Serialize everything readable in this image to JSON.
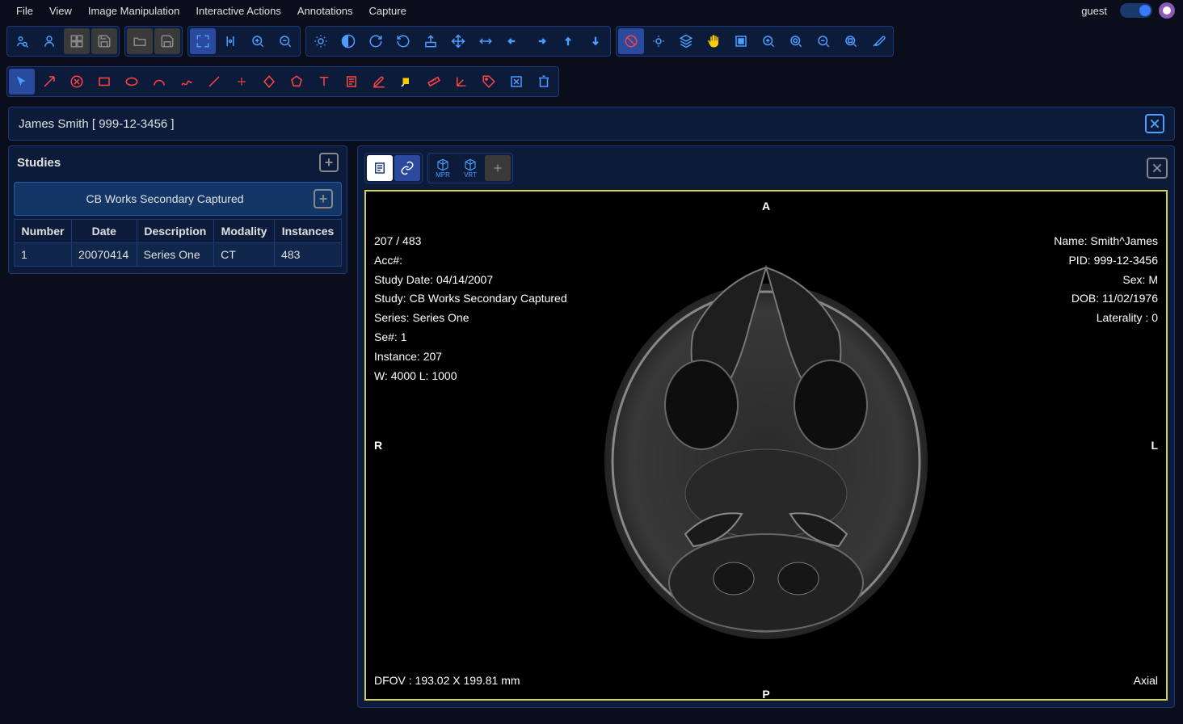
{
  "menu": {
    "items": [
      "File",
      "View",
      "Image Manipulation",
      "Interactive Actions",
      "Annotations",
      "Capture"
    ],
    "user": "guest"
  },
  "patient_header": "James Smith [ 999-12-3456 ]",
  "studies": {
    "title": "Studies",
    "study_name": "CB Works Secondary Captured",
    "columns": [
      "Number",
      "Date",
      "Description",
      "Modality",
      "Instances"
    ],
    "rows": [
      {
        "number": "1",
        "date": "20070414",
        "description": "Series One",
        "modality": "CT",
        "instances": "483"
      }
    ]
  },
  "viewer": {
    "mpr_label": "MPR",
    "vrt_label": "VRT",
    "orientation": {
      "a": "A",
      "p": "P",
      "r": "R",
      "l": "L"
    },
    "overlay_tl": {
      "counter": "207 / 483",
      "acc": "Acc#:",
      "study_date": "Study Date: 04/14/2007",
      "study": "Study: CB Works Secondary Captured",
      "series": "Series: Series One",
      "se_num": "Se#: 1",
      "instance": "Instance: 207",
      "wl": "W: 4000 L: 1000"
    },
    "overlay_tr": {
      "name": "Name: Smith^James",
      "pid": "PID: 999-12-3456",
      "sex": "Sex: M",
      "dob": "DOB: 11/02/1976",
      "laterality": "Laterality : 0"
    },
    "overlay_bl": {
      "dfov": "DFOV : 193.02 X 199.81 mm"
    },
    "overlay_br": {
      "view": "Axial"
    }
  }
}
